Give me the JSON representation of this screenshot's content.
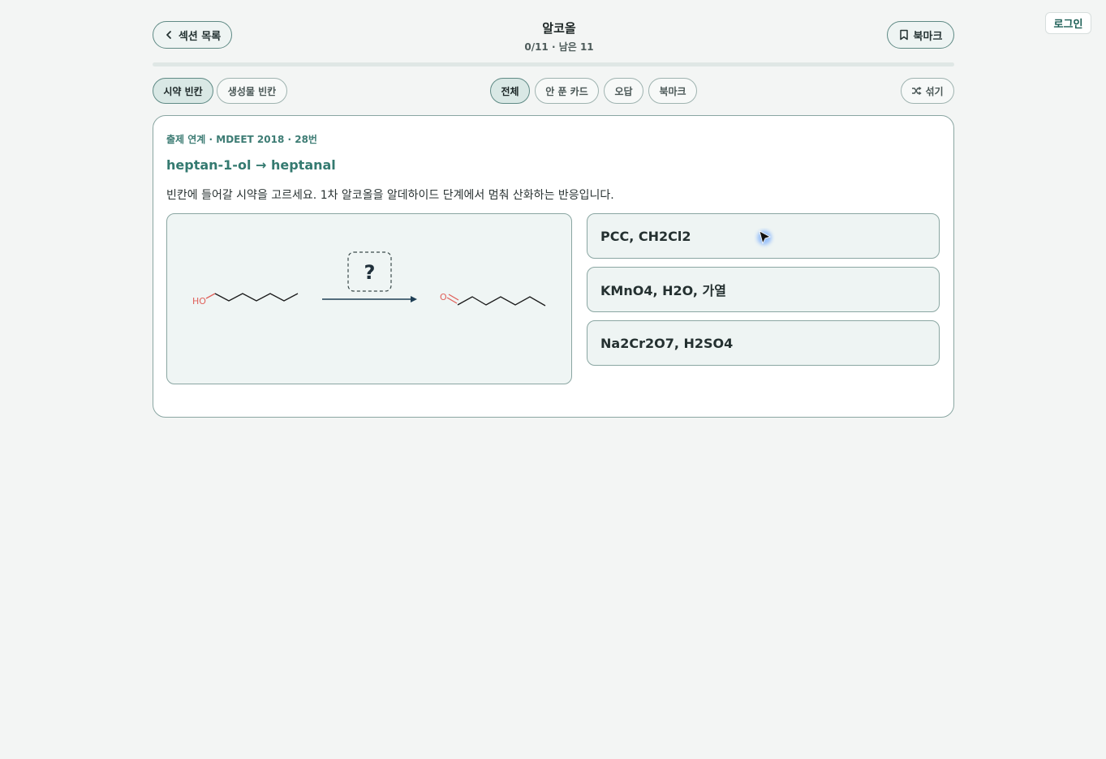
{
  "header": {
    "back_label": "섹션 목록",
    "title": "알코올",
    "progress_text": "0/11 · 남은 11",
    "progress_fraction": 0,
    "bookmark_label": "북마크",
    "login_label": "로그인"
  },
  "mode_tabs": [
    {
      "label": "시약 빈칸",
      "active": true
    },
    {
      "label": "생성물 빈칸",
      "active": false
    }
  ],
  "filters": [
    {
      "label": "전체",
      "active": true
    },
    {
      "label": "안 푼 카드",
      "active": false
    },
    {
      "label": "오답",
      "active": false
    },
    {
      "label": "북마크",
      "active": false
    }
  ],
  "shuffle_label": "섞기",
  "card": {
    "meta": "출제 연계 · MDEET 2018 · 28번",
    "question": "heptan-1-ol → heptanal",
    "instruction": "빈칸에 들어갈 시약을 고르세요. 1차 알코올을 알데하이드 단계에서 멈춰 산화하는 반응입니다.",
    "scheme": {
      "reactant_label": "HO",
      "placeholder": "?",
      "product_label": "O"
    },
    "options": [
      "PCC, CH2Cl2",
      "KMnO4, H2O, 가열",
      "Na2Cr2O7, H2SO4"
    ]
  },
  "colors": {
    "accent": "#3f8a80",
    "heteroatom": "#e0605a"
  }
}
